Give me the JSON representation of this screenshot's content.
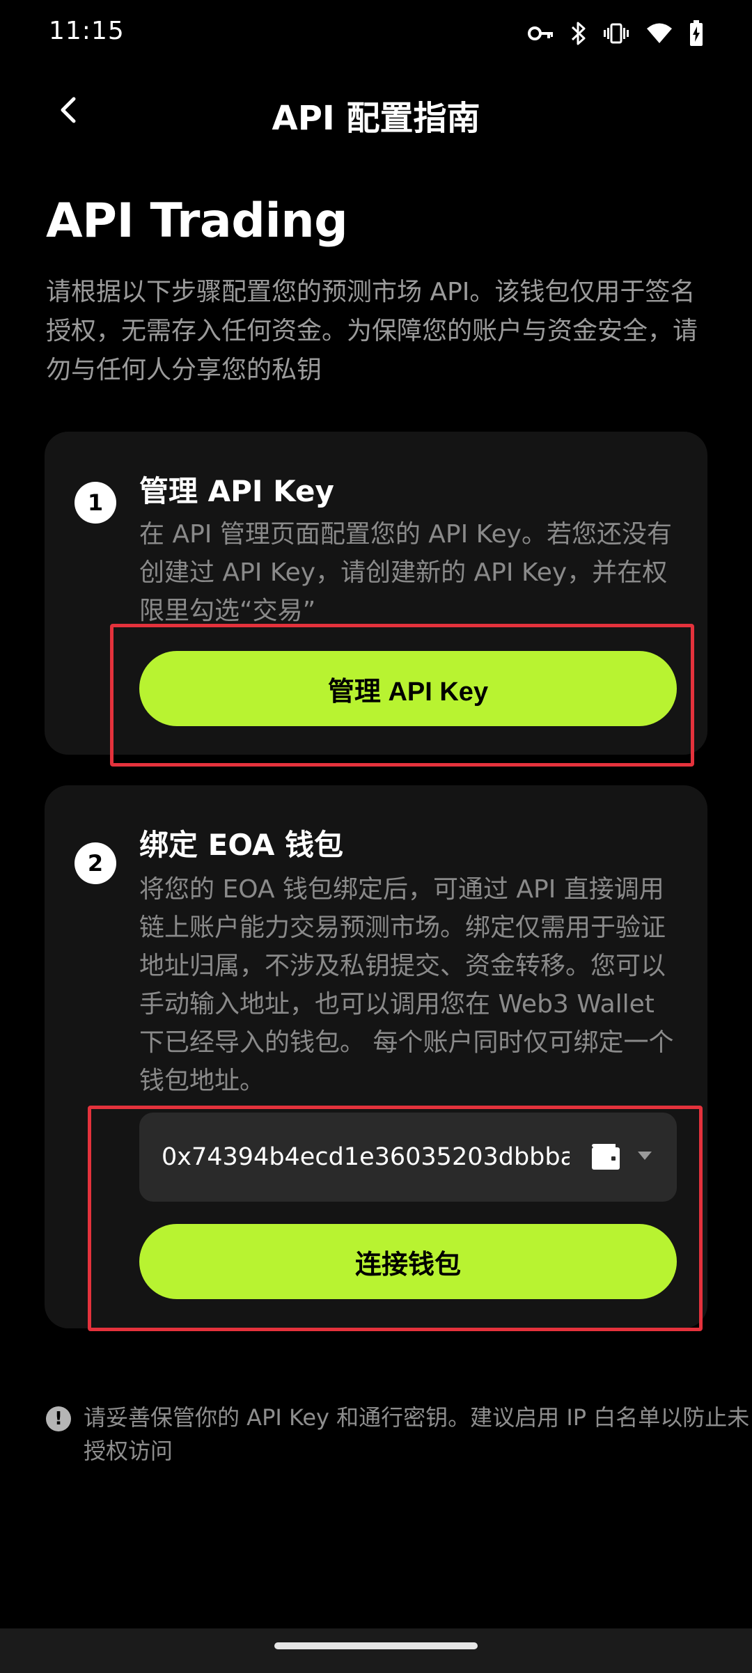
{
  "status_bar": {
    "time": "11:15",
    "icons": [
      "key-icon",
      "bluetooth-icon",
      "vibrate-icon",
      "wifi-icon",
      "battery-icon"
    ]
  },
  "header": {
    "title": "API 配置指南"
  },
  "page": {
    "title": "API Trading",
    "description": "请根据以下步骤配置您的预测市场 API。该钱包仅用于签名授权，无需存入任何资金。为保障您的账户与资金安全，请勿与任何人分享您的私钥"
  },
  "steps": [
    {
      "number": "1",
      "title": "管理 API Key",
      "description": "在 API 管理页面配置您的 API Key。若您还没有创建过 API Key，请创建新的 API Key，并在权限里勾选“交易”",
      "button_label": "管理 API Key"
    },
    {
      "number": "2",
      "title": "绑定 EOA 钱包",
      "description": "将您的 EOA 钱包绑定后，可通过 API 直接调用链上账户能力交易预测市场。绑定仅需用于验证地址归属，不涉及私钥提交、资金转移。您可以手动输入地址，也可以调用您在 Web3 Wallet 下已经导入的钱包。 每个账户同时仅可绑定一个钱包地址。",
      "wallet_address": "0x74394b4ecd1e36035203dbbba",
      "button_label": "连接钱包"
    }
  ],
  "notice": {
    "icon": "!",
    "text": "请妥善保管你的 API Key 和通行密钥。建议启用 IP 白名单以防止未授权访问"
  },
  "colors": {
    "background": "#000000",
    "card": "#141414",
    "accent": "#b8f331",
    "highlight": "#e4323c",
    "muted_text": "#8a8a8a"
  }
}
